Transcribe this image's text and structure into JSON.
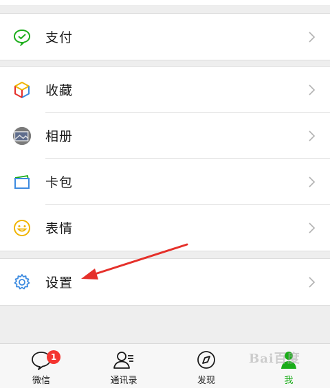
{
  "menu": {
    "groups": [
      {
        "items": [
          {
            "label": "支付",
            "icon": "pay-icon"
          }
        ]
      },
      {
        "items": [
          {
            "label": "收藏",
            "icon": "favorites-icon"
          },
          {
            "label": "相册",
            "icon": "album-icon"
          },
          {
            "label": "卡包",
            "icon": "card-wallet-icon"
          },
          {
            "label": "表情",
            "icon": "emoji-icon"
          }
        ]
      },
      {
        "items": [
          {
            "label": "设置",
            "icon": "settings-icon"
          }
        ]
      }
    ]
  },
  "tabbar": {
    "tabs": [
      {
        "label": "微信",
        "icon": "chat-icon",
        "badge": "1"
      },
      {
        "label": "通讯录",
        "icon": "contacts-icon"
      },
      {
        "label": "发现",
        "icon": "discover-compass-icon"
      },
      {
        "label": "我",
        "icon": "me-icon",
        "active": true
      }
    ]
  },
  "watermark": {
    "text": "Bai百度"
  },
  "colors": {
    "accent_green": "#1aad19",
    "settings_blue": "#3d8be0",
    "annotation_red": "#e5302a",
    "badge_red": "#f43530"
  }
}
